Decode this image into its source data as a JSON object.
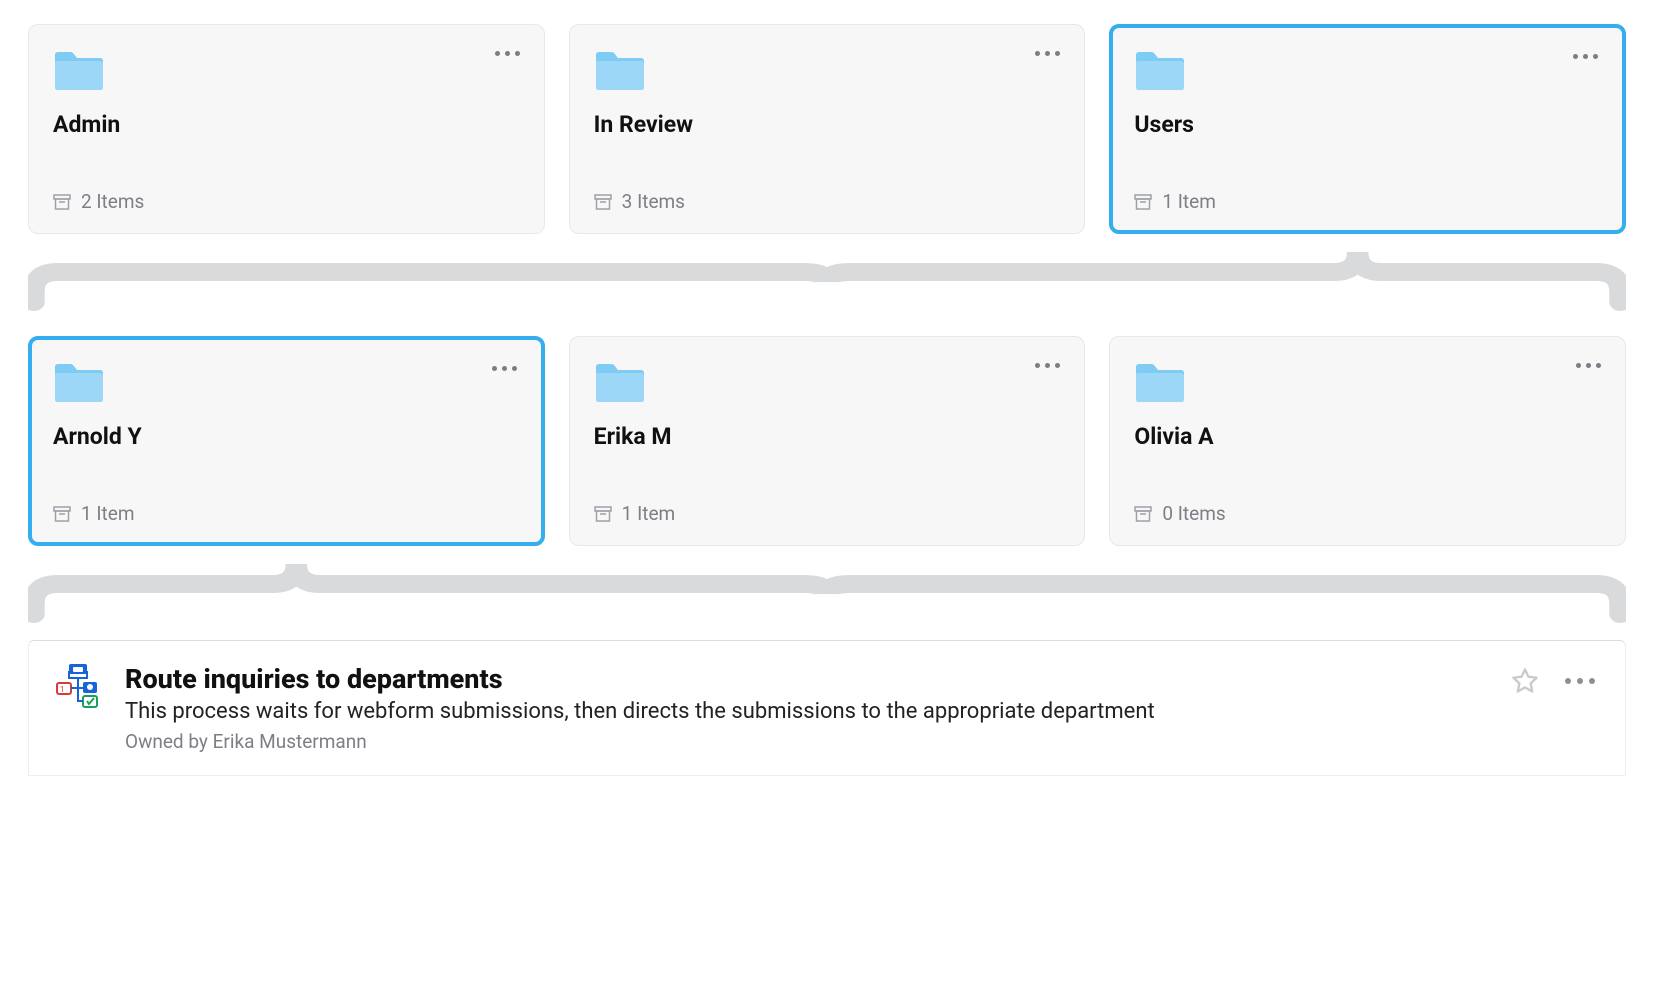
{
  "row1": [
    {
      "title": "Admin",
      "count": "2 Items",
      "selected": false
    },
    {
      "title": "In Review",
      "count": "3 Items",
      "selected": false
    },
    {
      "title": "Users",
      "count": "1 Item",
      "selected": true
    }
  ],
  "row2": [
    {
      "title": "Arnold Y",
      "count": "1 Item",
      "selected": true
    },
    {
      "title": "Erika M",
      "count": "1 Item",
      "selected": false
    },
    {
      "title": "Olivia A",
      "count": "0 Items",
      "selected": false
    }
  ],
  "task": {
    "title": "Route inquiries to departments",
    "description": "This process waits for webform submissions, then directs the submissions to the appropriate department",
    "owner": "Owned by Erika Mustermann"
  }
}
